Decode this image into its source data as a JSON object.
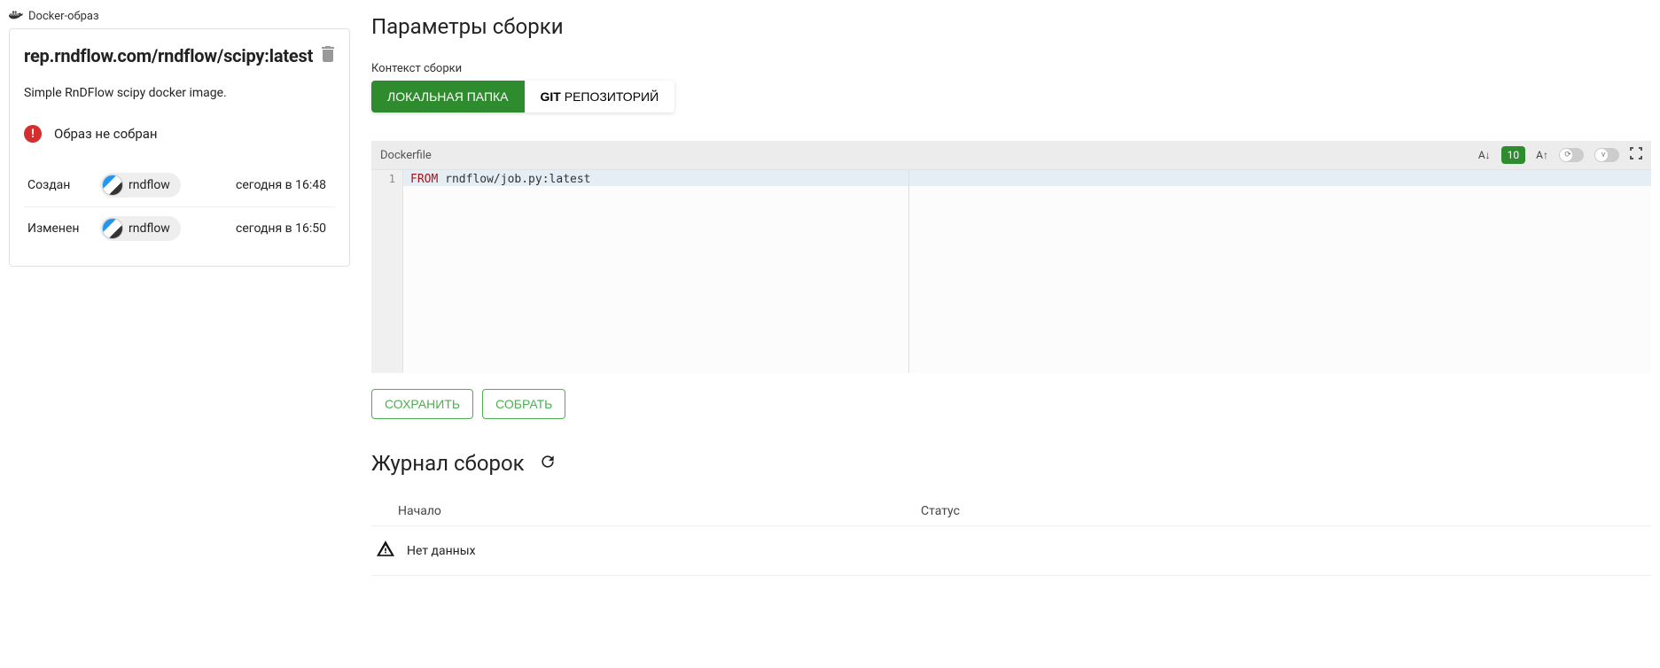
{
  "header": {
    "docker_image_label": "Docker-образ"
  },
  "card": {
    "title": "rep.rndflow.com/rndflow/scipy:latest",
    "description": "Simple RnDFlow scipy docker image.",
    "status_text": "Образ не собран",
    "meta": {
      "created_label": "Создан",
      "created_user": "rndflow",
      "created_date": "сегодня в 16:48",
      "modified_label": "Изменен",
      "modified_user": "rndflow",
      "modified_date": "сегодня в 16:50"
    }
  },
  "params": {
    "title": "Параметры сборки",
    "context_label": "Контекст сборки",
    "tab_local": "ЛОКАЛЬНАЯ ПАПКА",
    "tab_git_bold": "GIT",
    "tab_git_rest": " РЕПОЗИТОРИЙ"
  },
  "editor": {
    "filename": "Dockerfile",
    "font_size": "10",
    "line_number": "1",
    "code_keyword": "FROM",
    "code_rest": " rndflow/job.py:latest"
  },
  "buttons": {
    "save": "СОХРАНИТЬ",
    "build": "СОБРАТЬ"
  },
  "log": {
    "title": "Журнал сборок",
    "col_start": "Начало",
    "col_status": "Статус",
    "no_data": "Нет данных"
  }
}
